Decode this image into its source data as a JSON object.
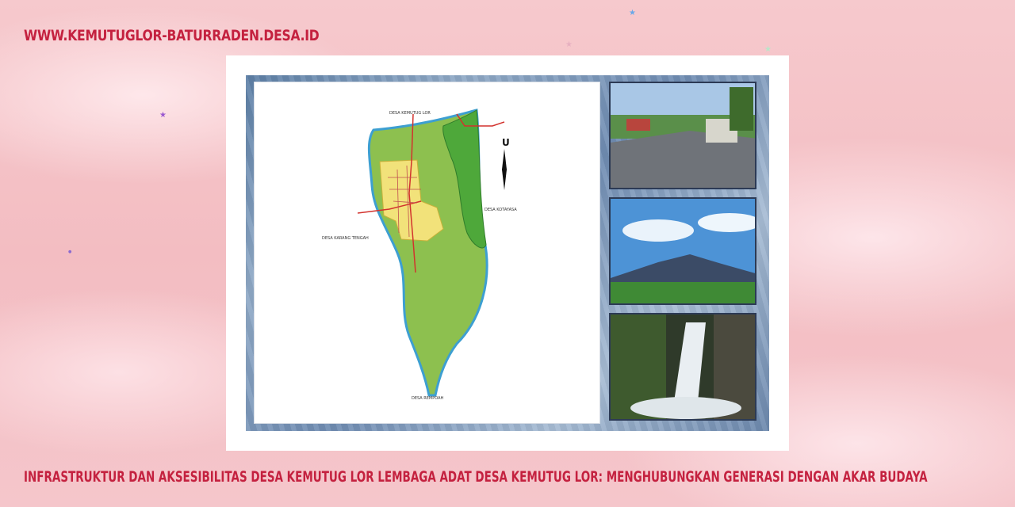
{
  "header": {
    "site_url": "WWW.KEMUTUGLOR-BATURRADEN.DESA.ID"
  },
  "image": {
    "map_labels": {
      "north": "DESA KEMUTUG LOR",
      "east": "DESA KOTAYASA",
      "west": "DESA KARANG TENGAH",
      "south": "DESA REMPOAH",
      "compass": "U"
    },
    "photos": [
      "village-road-photo",
      "mountain-landscape-photo",
      "waterfall-photo"
    ]
  },
  "footer": {
    "caption": "INFRASTRUKTUR DAN AKSESIBILITAS DESA KEMUTUG LOR LEMBAGA ADAT DESA KEMUTUG LOR: MENGHUBUNGKAN GENERASI DENGAN AKAR BUDAYA"
  },
  "colors": {
    "title_red": "#c4213f",
    "background_pink": "#f4c2c6",
    "map_green": "#8dc04f",
    "map_yellow": "#f2e27a"
  }
}
